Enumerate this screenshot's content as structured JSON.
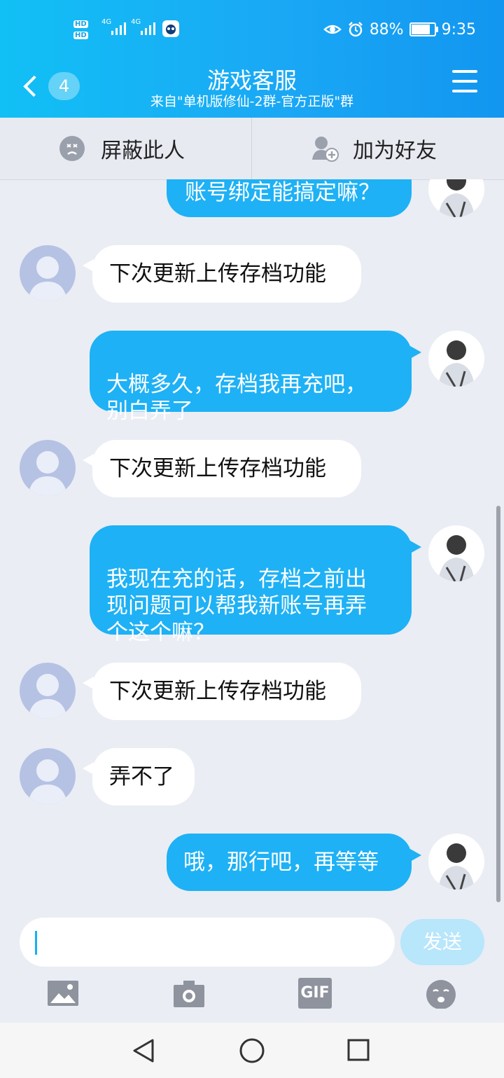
{
  "status": {
    "left_labels": [
      "HD",
      "HD",
      "4G",
      "4G"
    ],
    "battery_percent": "88%",
    "battery_level": 0.88,
    "time": "9:35"
  },
  "header": {
    "back_count": "4",
    "title": "游戏客服",
    "subtitle": "来自\"单机版修仙-2群-官方正版\"群"
  },
  "actions": {
    "block": "屏蔽此人",
    "add_friend": "加为好友"
  },
  "messages": [
    {
      "from": "me",
      "text": "账号绑定能搞定嘛？"
    },
    {
      "from": "them",
      "text": "下次更新上传存档功能"
    },
    {
      "from": "me",
      "text": "大概多久，存档我再充吧，\n别白弄了"
    },
    {
      "from": "them",
      "text": "下次更新上传存档功能"
    },
    {
      "from": "me",
      "text": "我现在充的话，存档之前出\n现问题可以帮我新账号再弄\n个这个嘛？"
    },
    {
      "from": "them",
      "text": "下次更新上传存档功能"
    },
    {
      "from": "them",
      "text": "弄不了"
    },
    {
      "from": "me",
      "text": "哦，那行吧，再等等"
    }
  ],
  "input": {
    "value": "",
    "send_label": "发送"
  },
  "toolbar": {
    "gif_label": "GIF"
  }
}
